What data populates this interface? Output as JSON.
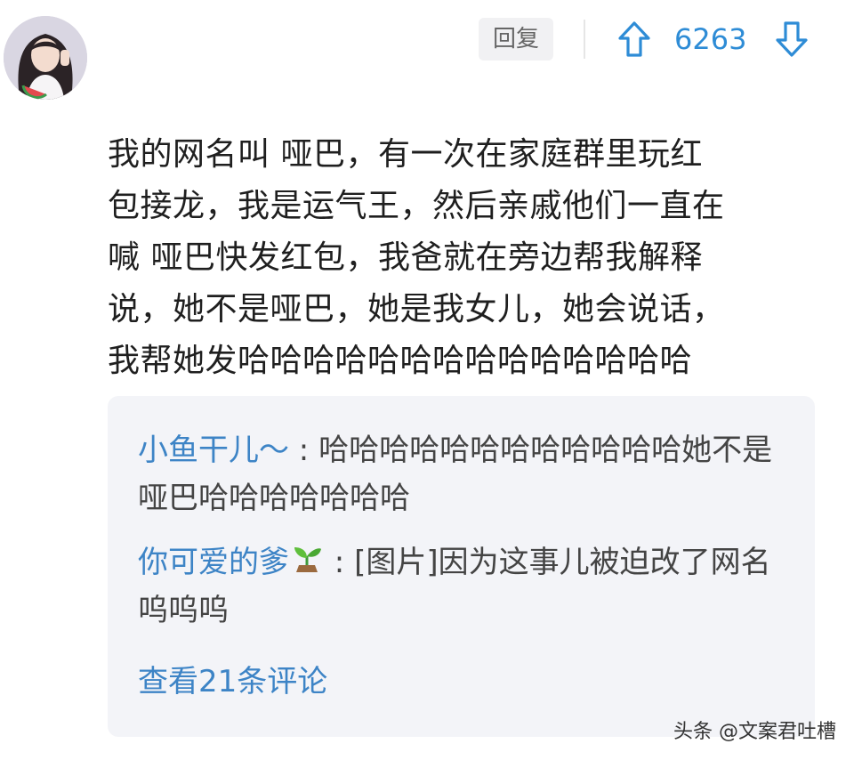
{
  "comment": {
    "reply_label": "回复",
    "vote_count": "6263",
    "text": "我的网名叫  哑巴，有一次在家庭群里玩红\n包接龙，我是运气王，然后亲戚他们一直在\n喊 哑巴快发红包，我爸就在旁边帮我解释\n说，她不是哑巴，她是我女儿，她会说话，\n我帮她发哈哈哈哈哈哈哈哈哈哈哈哈哈哈"
  },
  "replies": [
    {
      "user": "小鱼干儿～",
      "separator": " : ",
      "text": "哈哈哈哈哈哈哈哈哈哈哈哈她不是哑巴哈哈哈哈哈哈哈"
    },
    {
      "user": "你可爱的爹",
      "separator": " : ",
      "text": "[图片]因为这事儿被迫改了网名呜呜呜"
    }
  ],
  "view_more": "查看21条评论",
  "watermark": "头条 @文案君吐槽",
  "colors": {
    "accent_blue": "#2e8cd6",
    "username_blue": "#3d84c6",
    "reply_box_bg": "#f3f4f8"
  },
  "icons": {
    "upvote": "arrow-up-icon",
    "downvote": "arrow-down-icon",
    "sprout": "seedling-icon"
  }
}
